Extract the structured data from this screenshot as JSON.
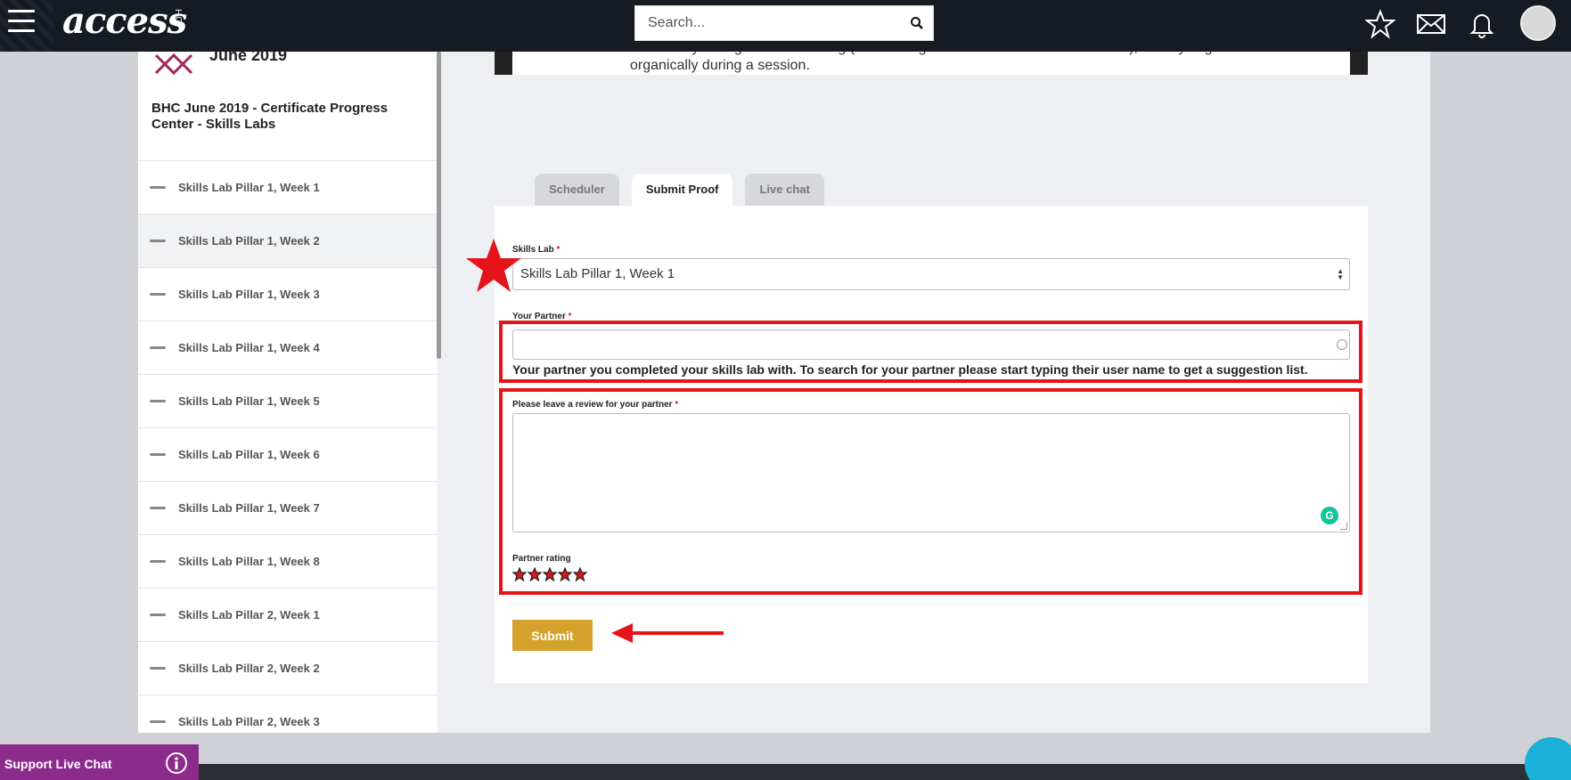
{
  "header": {
    "logo_text": "access",
    "logo_sub": "HCI",
    "search_placeholder": "Search..."
  },
  "sidebar": {
    "date": "June 2019",
    "title": "BHC June 2019 - Certificate Progress Center - Skills Labs",
    "items": [
      {
        "label": "Skills Lab Pillar 1, Week 1"
      },
      {
        "label": "Skills Lab Pillar 1, Week 2"
      },
      {
        "label": "Skills Lab Pillar 1, Week 3"
      },
      {
        "label": "Skills Lab Pillar 1, Week 4"
      },
      {
        "label": "Skills Lab Pillar 1, Week 5"
      },
      {
        "label": "Skills Lab Pillar 1, Week 6"
      },
      {
        "label": "Skills Lab Pillar 1, Week 7"
      },
      {
        "label": "Skills Lab Pillar 1, Week 8"
      },
      {
        "label": "Skills Lab Pillar 2, Week 1"
      },
      {
        "label": "Skills Lab Pillar 2, Week 2"
      },
      {
        "label": "Skills Lab Pillar 2, Week 3"
      }
    ]
  },
  "content": {
    "intro_text": "materials you're given in a training (we're using BHC handouts in this Skills Lab), or they might evolve organically during a session.",
    "tabs": [
      {
        "label": "Scheduler"
      },
      {
        "label": "Submit Proof"
      },
      {
        "label": "Live chat"
      }
    ]
  },
  "form": {
    "skills_lab_label": "Skills Lab",
    "skills_lab_value": "Skills Lab Pillar 1, Week 1",
    "partner_label": "Your Partner",
    "partner_value": "",
    "partner_help": "Your partner you completed your skills lab with. To search for your partner please start typing their user name to get a suggestion list.",
    "review_label": "Please leave a review for your partner",
    "review_value": "",
    "rating_label": "Partner rating",
    "rating_value": 5,
    "rating_max": 5,
    "required_mark": "*",
    "submit_label": "Submit"
  },
  "footer": {
    "live_chat_label": "Support Live Chat"
  },
  "colors": {
    "accent": "#d6a22e",
    "annotation": "#e5141b",
    "topbar": "#161a22",
    "live_chat": "#8c2b8c"
  }
}
